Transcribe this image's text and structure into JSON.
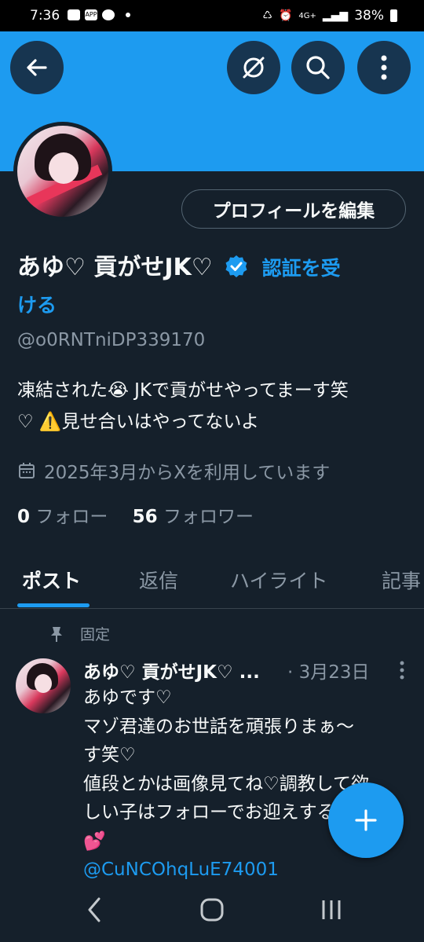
{
  "status_bar": {
    "time": "7:36",
    "battery": "38%",
    "network": "4G+"
  },
  "header": {
    "back_icon": "arrow-left-icon",
    "grok_icon": "slashed-circle-icon",
    "search_icon": "search-icon",
    "more_icon": "more-vertical-icon"
  },
  "profile": {
    "edit_button": "プロフィールを編集",
    "name": "あゆ♡ 貢がせJK♡",
    "verify_link_line1": "認証を受",
    "verify_link_line2": "ける",
    "handle": "@o0RNTniDP339170",
    "bio_line1": "凍結された😭 JKで貢がせやってまーす笑",
    "bio_line2": "♡ ⚠️見せ合いはやってないよ",
    "joined": "2025年3月からXを利用しています",
    "following_count": "0",
    "following_label": "フォロー",
    "followers_count": "56",
    "followers_label": "フォロワー"
  },
  "tabs": [
    {
      "label": "ポスト"
    },
    {
      "label": "返信"
    },
    {
      "label": "ハイライト"
    },
    {
      "label": "記事"
    }
  ],
  "post": {
    "pinned_label": "固定",
    "author": "あゆ♡ 貢がせJK♡ ...",
    "date": "· 3月23日",
    "lines": [
      "あゆです♡",
      "マゾ君達のお世話を頑張りまぁ〜",
      "す笑♡",
      "値段とかは画像見てね♡調教して欲",
      "しい子はフォローでお迎えする",
      "💕"
    ],
    "link": "@CuNCOhqLuE74001"
  },
  "colors": {
    "accent": "#1d9bf0",
    "background": "#15202b",
    "muted": "#8b98a5"
  }
}
